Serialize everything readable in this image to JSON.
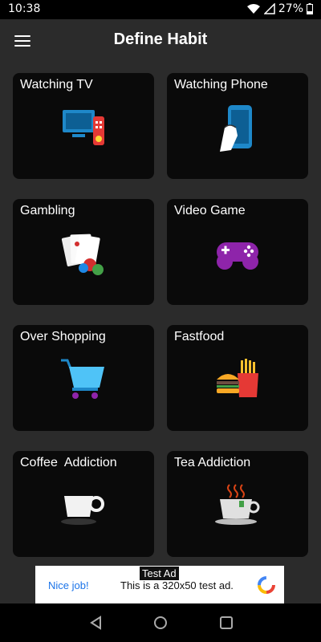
{
  "status": {
    "time": "10:38",
    "battery": "27%"
  },
  "header": {
    "title": "Define Habit"
  },
  "habits": [
    {
      "label": "Watching TV",
      "icon": "tv-icon"
    },
    {
      "label": "Watching Phone",
      "icon": "phone-icon"
    },
    {
      "label": "Gambling",
      "icon": "playing-cards-icon"
    },
    {
      "label": "Video Game",
      "icon": "gamepad-icon"
    },
    {
      "label": "Over Shopping",
      "icon": "shopping-cart-icon"
    },
    {
      "label": "Fastfood",
      "icon": "fastfood-icon"
    },
    {
      "label": "Coffee  Addiction",
      "icon": "coffee-cup-icon"
    },
    {
      "label": "Tea Addiction",
      "icon": "tea-cup-icon"
    }
  ],
  "ad": {
    "badge": "Test Ad",
    "title": "Nice job!",
    "text": "This is a 320x50 test ad."
  },
  "colors": {
    "background": "#2b2b2b",
    "card": "#0a0a0a",
    "ad_link": "#1a73e8"
  }
}
